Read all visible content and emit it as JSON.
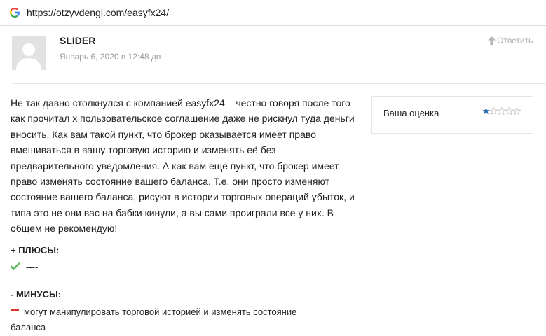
{
  "browser": {
    "url": "https://otzyvdengi.com/easyfx24/"
  },
  "comment": {
    "author": "SLIDER",
    "date": "Январь 6, 2020 в 12:48 дп",
    "reply_label": "Ответить",
    "text": "Не так давно столкнулся с компанией easyfx24 – честно говоря после того как прочитал х пользовательское соглашение даже не рискнул туда деньги вносить. Как вам такой пункт, что брокер оказывается имеет право вмешиваться в вашу торговую историю и изменять её без предварительного уведомления. А как вам еще пункт, что брокер имеет право изменять состояние вашего баланса. Т.е. они просто изменяют состояние вашего баланса, рисуют в истории торговых операций убыток, и типа это не они вас на бабки кинули, а вы сами проиграли все у них. В общем не рекомендую!",
    "rating": {
      "label": "Ваша оценка",
      "value": 1,
      "max": 5
    },
    "pros": {
      "title": "+ ПЛЮСЫ:",
      "items": [
        "----"
      ]
    },
    "cons": {
      "title": "- МИНУСЫ:",
      "items": [
        "могут манипулировать торговой историей и изменять состояние баланса"
      ]
    }
  },
  "colors": {
    "pros_icon": "#5cb85c",
    "cons_icon": "#e0322d",
    "star_filled": "#2a6fb0",
    "star_empty": "#c8c8c8"
  }
}
